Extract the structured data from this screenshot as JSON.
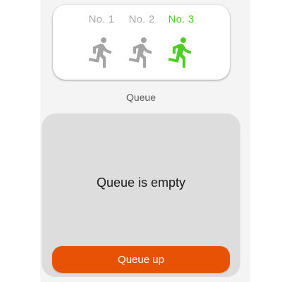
{
  "selector": {
    "slots": [
      {
        "label": "No. 1",
        "icon": "runner-icon",
        "active": false
      },
      {
        "label": "No. 2",
        "icon": "runner-icon",
        "active": false
      },
      {
        "label": "No. 3",
        "icon": "runner-icon",
        "active": true
      }
    ],
    "inactive_color": "#a4a4a4",
    "active_color": "#4ccf22"
  },
  "queue": {
    "title": "Queue",
    "empty_message": "Queue is empty",
    "action_label": "Queue up",
    "action_color": "#e85204"
  }
}
